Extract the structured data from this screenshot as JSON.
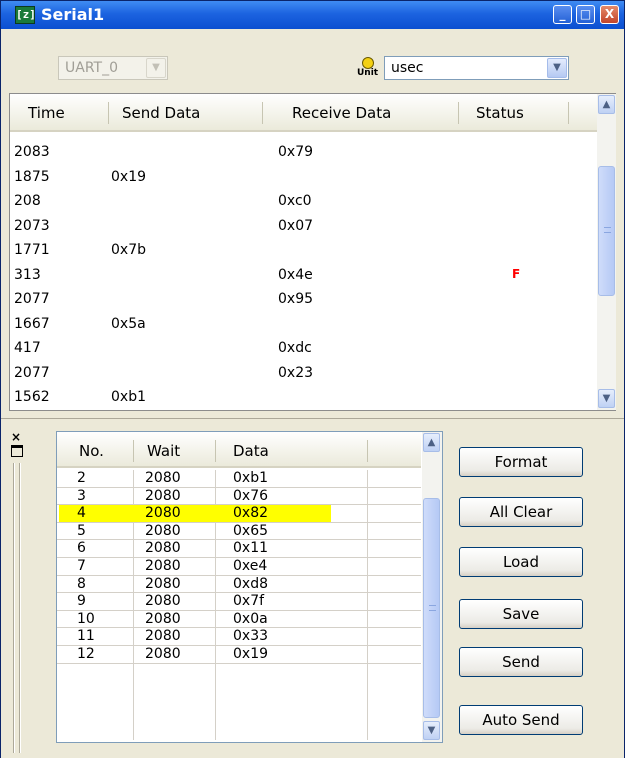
{
  "window": {
    "title": "Serial1",
    "app_icon": "[z]"
  },
  "titlebar_buttons": {
    "minimize": "_",
    "maximize": "□",
    "close": "X"
  },
  "toolbar": {
    "port": {
      "value": "UART_0",
      "disabled": true
    },
    "unit_icon_label": "Unit",
    "unit": {
      "value": "usec"
    }
  },
  "log": {
    "columns": [
      "Time",
      "Send Data",
      "Receive Data",
      "Status"
    ],
    "rows": [
      {
        "time": "2083",
        "send": "",
        "receive": "0x79",
        "status": ""
      },
      {
        "time": "1875",
        "send": "0x19",
        "receive": "",
        "status": ""
      },
      {
        "time": "208",
        "send": "",
        "receive": "0xc0",
        "status": ""
      },
      {
        "time": "2073",
        "send": "",
        "receive": "0x07",
        "status": ""
      },
      {
        "time": "1771",
        "send": "0x7b",
        "receive": "",
        "status": ""
      },
      {
        "time": "313",
        "send": "",
        "receive": "0x4e",
        "status": "F"
      },
      {
        "time": "2077",
        "send": "",
        "receive": "0x95",
        "status": ""
      },
      {
        "time": "1667",
        "send": "0x5a",
        "receive": "",
        "status": ""
      },
      {
        "time": "417",
        "send": "",
        "receive": "0xdc",
        "status": ""
      },
      {
        "time": "2077",
        "send": "",
        "receive": "0x23",
        "status": ""
      },
      {
        "time": "1562",
        "send": "0xb1",
        "receive": "",
        "status": ""
      }
    ],
    "status_color": "#ff0000"
  },
  "dock": {
    "close_glyph": "×"
  },
  "sequence": {
    "columns": [
      "No.",
      "Wait",
      "Data"
    ],
    "rows": [
      {
        "no": "2",
        "wait": "2080",
        "data": "0xb1"
      },
      {
        "no": "3",
        "wait": "2080",
        "data": "0x76"
      },
      {
        "no": "4",
        "wait": "2080",
        "data": "0x82"
      },
      {
        "no": "5",
        "wait": "2080",
        "data": "0x65"
      },
      {
        "no": "6",
        "wait": "2080",
        "data": "0x11"
      },
      {
        "no": "7",
        "wait": "2080",
        "data": "0xe4"
      },
      {
        "no": "8",
        "wait": "2080",
        "data": "0xd8"
      },
      {
        "no": "9",
        "wait": "2080",
        "data": "0x7f"
      },
      {
        "no": "10",
        "wait": "2080",
        "data": "0x0a"
      },
      {
        "no": "11",
        "wait": "2080",
        "data": "0x33"
      },
      {
        "no": "12",
        "wait": "2080",
        "data": "0x19"
      }
    ],
    "selected_no": "4",
    "highlight_color": "#ffff00"
  },
  "buttons": {
    "format": "Format",
    "all_clear": "All Clear",
    "load": "Load",
    "save": "Save",
    "send": "Send",
    "auto_send": "Auto Send"
  }
}
